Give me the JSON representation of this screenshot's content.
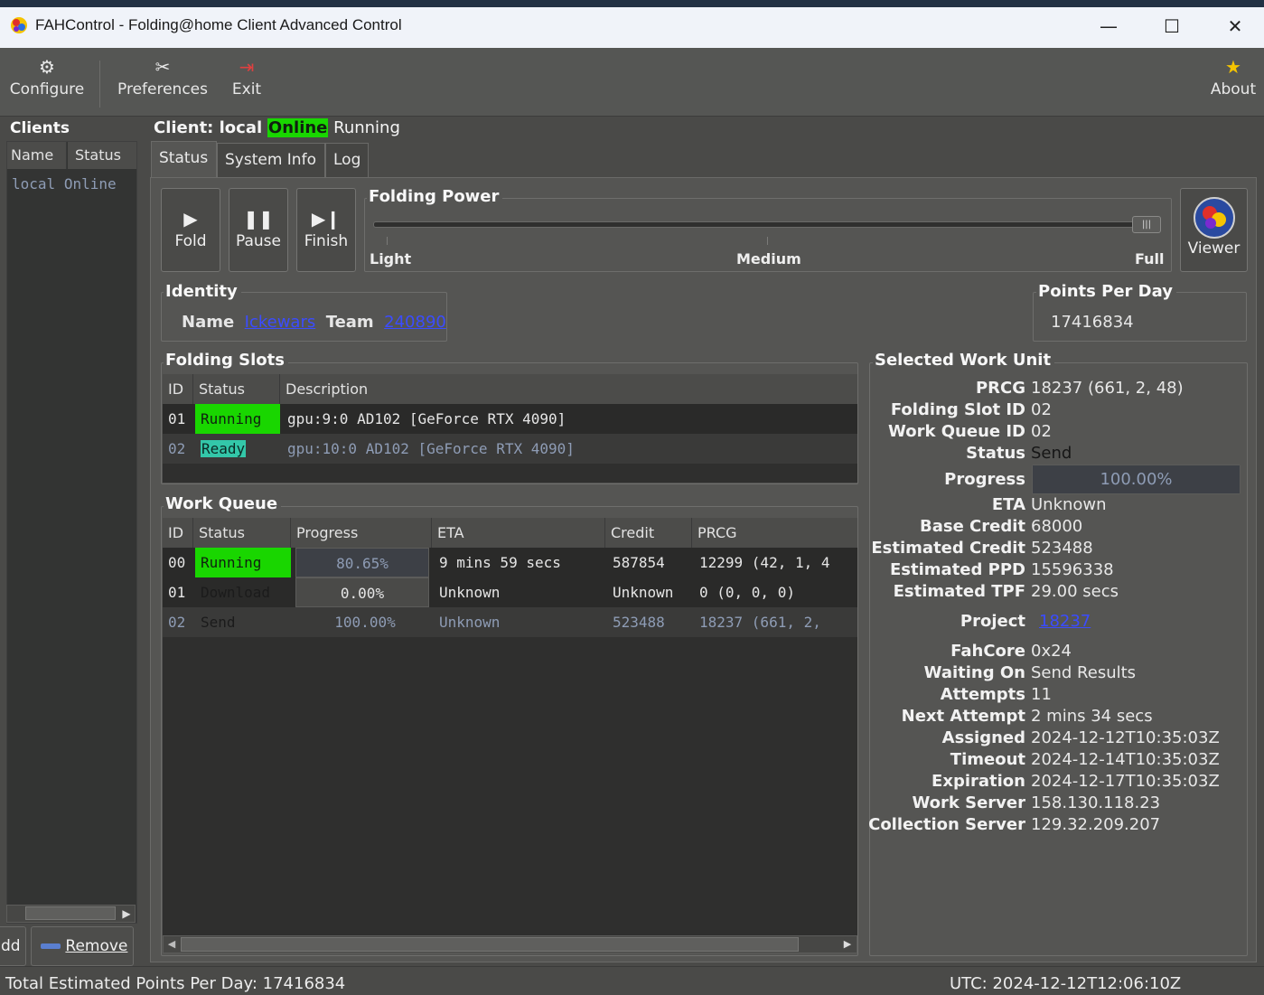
{
  "window": {
    "title": "FAHControl - Folding@home Client Advanced Control",
    "minimize": "—",
    "maximize": "☐",
    "close": "✕"
  },
  "toolbar": {
    "configure": "Configure",
    "preferences": "Preferences",
    "exit": "Exit",
    "about": "About"
  },
  "clients": {
    "title": "Clients",
    "col_name": "Name",
    "col_status": "Status",
    "row_name": "local",
    "row_status": "Online",
    "add": "dd",
    "remove": "Remove"
  },
  "client": {
    "label": "Client: local",
    "online": "Online",
    "state": "Running"
  },
  "tabs": [
    "Status",
    "System Info",
    "Log"
  ],
  "controls": {
    "fold": "Fold",
    "pause": "Pause",
    "finish": "Finish",
    "viewer": "Viewer"
  },
  "folding_power": {
    "title": "Folding Power",
    "light": "Light",
    "medium": "Medium",
    "full": "Full",
    "level": 1.0
  },
  "identity": {
    "title": "Identity",
    "name_label": "Name",
    "name": "Ickewars",
    "team_label": "Team",
    "team": "240890"
  },
  "ppd": {
    "title": "Points Per Day",
    "value": "17416834"
  },
  "folding_slots": {
    "title": "Folding Slots",
    "headers": [
      "ID",
      "Status",
      "Description"
    ],
    "rows": [
      {
        "id": "01",
        "status": "Running",
        "desc": "gpu:9:0 AD102 [GeForce RTX 4090]"
      },
      {
        "id": "02",
        "status": "Ready",
        "desc": "gpu:10:0 AD102 [GeForce RTX 4090]"
      }
    ]
  },
  "work_queue": {
    "title": "Work Queue",
    "headers": [
      "ID",
      "Status",
      "Progress",
      "ETA",
      "Credit",
      "PRCG"
    ],
    "rows": [
      {
        "id": "00",
        "status": "Running",
        "progress": "80.65%",
        "eta": "9 mins 59 secs",
        "credit": "587854",
        "prcg": "12299 (42, 1, 4"
      },
      {
        "id": "01",
        "status": "Download",
        "progress": "0.00%",
        "eta": "Unknown",
        "credit": "Unknown",
        "prcg": "0 (0, 0, 0)"
      },
      {
        "id": "02",
        "status": "Send",
        "progress": "100.00%",
        "eta": "Unknown",
        "credit": "523488",
        "prcg": "18237 (661, 2,"
      }
    ]
  },
  "selected_wu": {
    "title": "Selected Work Unit",
    "prcg_label": "PRCG",
    "prcg": "18237 (661, 2, 48)",
    "slot_label": "Folding Slot ID",
    "slot": "02",
    "queue_label": "Work Queue ID",
    "queue": "02",
    "status_label": "Status",
    "status": "Send",
    "progress_label": "Progress",
    "progress": "100.00%",
    "eta_label": "ETA",
    "eta": "Unknown",
    "base_label": "Base Credit",
    "base": "68000",
    "est_credit_label": "Estimated Credit",
    "est_credit": "523488",
    "est_ppd_label": "Estimated PPD",
    "est_ppd": "15596338",
    "est_tpf_label": "Estimated TPF",
    "est_tpf": "29.00 secs",
    "project_label": "Project",
    "project": "18237",
    "fahcore_label": "FahCore",
    "fahcore": "0x24",
    "waiting_label": "Waiting On",
    "waiting": "Send Results",
    "attempts_label": "Attempts",
    "attempts": "11",
    "next_label": "Next Attempt",
    "next": "2 mins 34 secs",
    "assigned_label": "Assigned",
    "assigned": "2024-12-12T10:35:03Z",
    "timeout_label": "Timeout",
    "timeout": "2024-12-14T10:35:03Z",
    "expiration_label": "Expiration",
    "expiration": "2024-12-17T10:35:03Z",
    "ws_label": "Work Server",
    "ws": "158.130.118.23",
    "cs_label": "Collection Server",
    "cs": "129.32.209.207"
  },
  "statusbar": {
    "total": "Total Estimated Points Per Day: 17416834",
    "utc": "UTC: 2024-12-12T12:06:10Z"
  },
  "colors": {
    "running": "#19d600",
    "ready": "#33c7a9",
    "link": "#3b4cff"
  }
}
